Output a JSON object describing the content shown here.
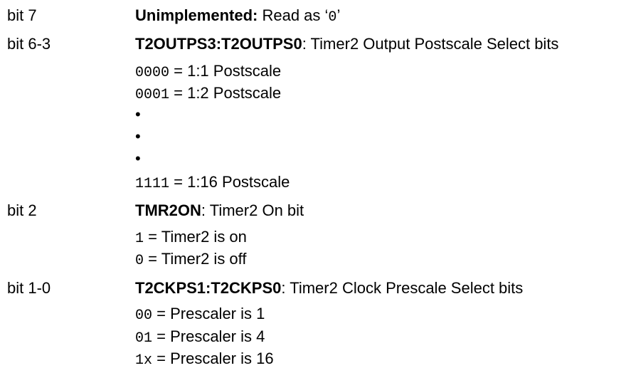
{
  "bit7": {
    "label": "bit 7",
    "name": "Unimplemented:",
    "desc_prefix": " Read as ‘",
    "code": "0",
    "desc_suffix": "’"
  },
  "bit63": {
    "label": "bit 6-3",
    "name": "T2OUTPS3:T2OUTPS0",
    "desc": ": Timer2 Output Postscale Select bits",
    "options": [
      {
        "code": "0000",
        "text": " = 1:1 Postscale"
      },
      {
        "code": "0001",
        "text": " = 1:2 Postscale"
      },
      {
        "code": "1111",
        "text": " = 1:16 Postscale"
      }
    ],
    "bullet": "•"
  },
  "bit2": {
    "label": "bit 2",
    "name": "TMR2ON",
    "desc": ": Timer2 On bit",
    "options": [
      {
        "code": "1",
        "text": " = Timer2 is on"
      },
      {
        "code": "0",
        "text": " = Timer2 is off"
      }
    ]
  },
  "bit10": {
    "label": "bit 1-0",
    "name": "T2CKPS1:T2CKPS0",
    "desc": ": Timer2 Clock Prescale Select bits",
    "options": [
      {
        "code": "00",
        "text": " = Prescaler is 1"
      },
      {
        "code": "01",
        "text": " = Prescaler is 4"
      },
      {
        "code": "1x",
        "text": " = Prescaler is 16"
      }
    ]
  }
}
